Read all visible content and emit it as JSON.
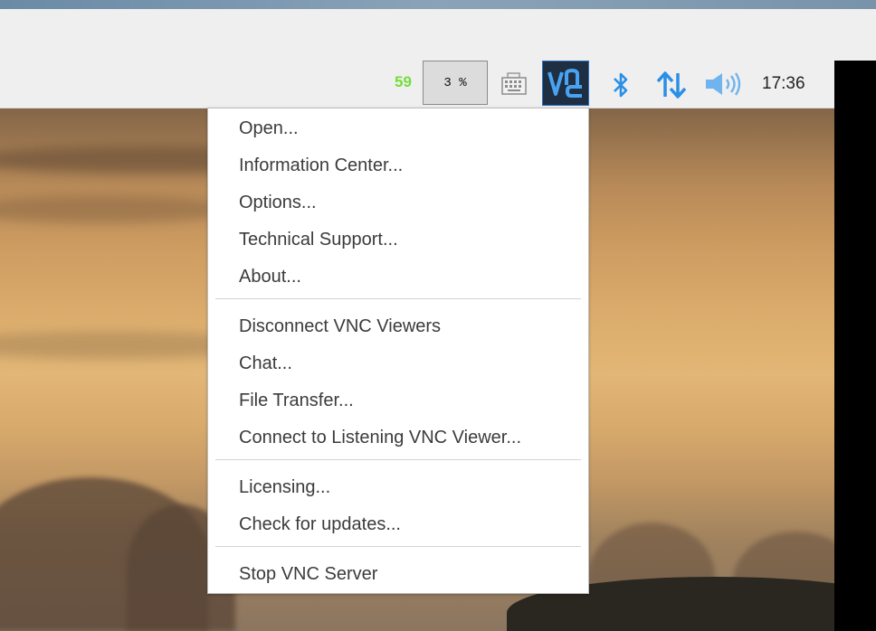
{
  "taskbar": {
    "cpu_value": "59",
    "cpu_percent": "3 %",
    "clock": "17:36",
    "icons": [
      "keyboard-icon",
      "vnc-icon",
      "bluetooth-icon",
      "network-icon",
      "volume-icon"
    ],
    "colors": {
      "cpu_value": "#74dd3c",
      "vnc_bg": "#1e2f44",
      "vnc_border": "#2c6fc0",
      "tray_accent": "#2a8fe6"
    }
  },
  "menu": {
    "items": [
      "Open...",
      "Information Center...",
      "Options...",
      "Technical Support...",
      "About...",
      "Disconnect VNC Viewers",
      "Chat...",
      "File Transfer...",
      "Connect to Listening VNC Viewer...",
      "Licensing...",
      "Check for updates...",
      "Stop VNC Server"
    ]
  }
}
